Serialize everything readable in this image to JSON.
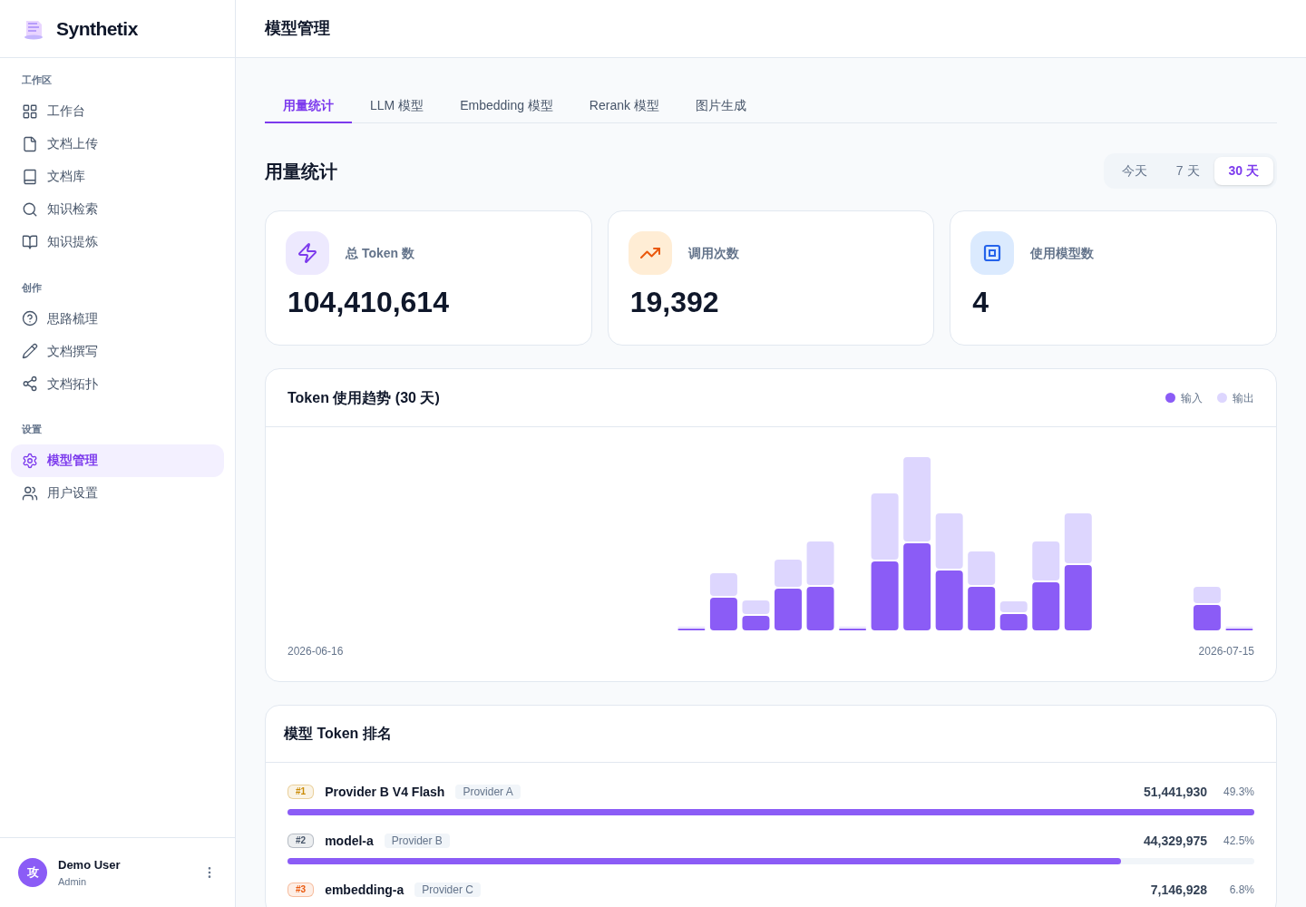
{
  "brand": {
    "name": "Synthetix"
  },
  "sidebar": {
    "sections": [
      {
        "title": "工作区",
        "items": [
          {
            "label": "工作台",
            "selected": false
          },
          {
            "label": "文档上传",
            "selected": false
          },
          {
            "label": "文档库",
            "selected": false
          },
          {
            "label": "知识检索",
            "selected": false
          },
          {
            "label": "知识提炼",
            "selected": false
          }
        ]
      },
      {
        "title": "创作",
        "items": [
          {
            "label": "思路梳理",
            "selected": false
          },
          {
            "label": "文档撰写",
            "selected": false
          },
          {
            "label": "文档拓扑",
            "selected": false
          }
        ]
      },
      {
        "title": "设置",
        "items": [
          {
            "label": "模型管理",
            "selected": true
          },
          {
            "label": "用户设置",
            "selected": false
          }
        ]
      }
    ]
  },
  "user": {
    "avatar": "攻",
    "name": "Demo User",
    "role": "Admin"
  },
  "header": {
    "title": "模型管理"
  },
  "tabs": [
    {
      "label": "用量统计",
      "selected": true
    },
    {
      "label": "LLM 模型",
      "selected": false
    },
    {
      "label": "Embedding 模型",
      "selected": false
    },
    {
      "label": "Rerank 模型",
      "selected": false
    },
    {
      "label": "图片生成",
      "selected": false
    }
  ],
  "section_title": "用量统计",
  "ranges": [
    {
      "label": "今天",
      "selected": false
    },
    {
      "label": "7 天",
      "selected": false
    },
    {
      "label": "30 天",
      "selected": true
    }
  ],
  "stats": [
    {
      "kind": "tokens",
      "label": "总 Token 数",
      "value": "104,410,614"
    },
    {
      "kind": "calls",
      "label": "调用次数",
      "value": "19,392"
    },
    {
      "kind": "models",
      "label": "使用模型数",
      "value": "4"
    }
  ],
  "trend": {
    "title": "Token 使用趋势 (30 天)",
    "legend": [
      {
        "label": "输入",
        "color": "#8b5cf6"
      },
      {
        "label": "输出",
        "color": "#ddd6fe"
      }
    ],
    "start_label": "2026-06-16",
    "end_label": "2026-07-15"
  },
  "ranking": {
    "title": "模型 Token 排名",
    "rows": [
      {
        "rank": "#1",
        "name": "Provider B V4 Flash",
        "provider": "Provider A",
        "tokens": "51,441,930",
        "share": "49.3%",
        "color": "#ca8a04",
        "level": 1.0
      },
      {
        "rank": "#2",
        "name": "model-a",
        "provider": "Provider B",
        "tokens": "44,329,975",
        "share": "42.5%",
        "color": "#475569",
        "level": 0.862
      },
      {
        "rank": "#3",
        "name": "embedding-a",
        "provider": "Provider C",
        "tokens": "7,146,928",
        "share": "6.8%",
        "color": "#ea580c"
      }
    ]
  }
}
